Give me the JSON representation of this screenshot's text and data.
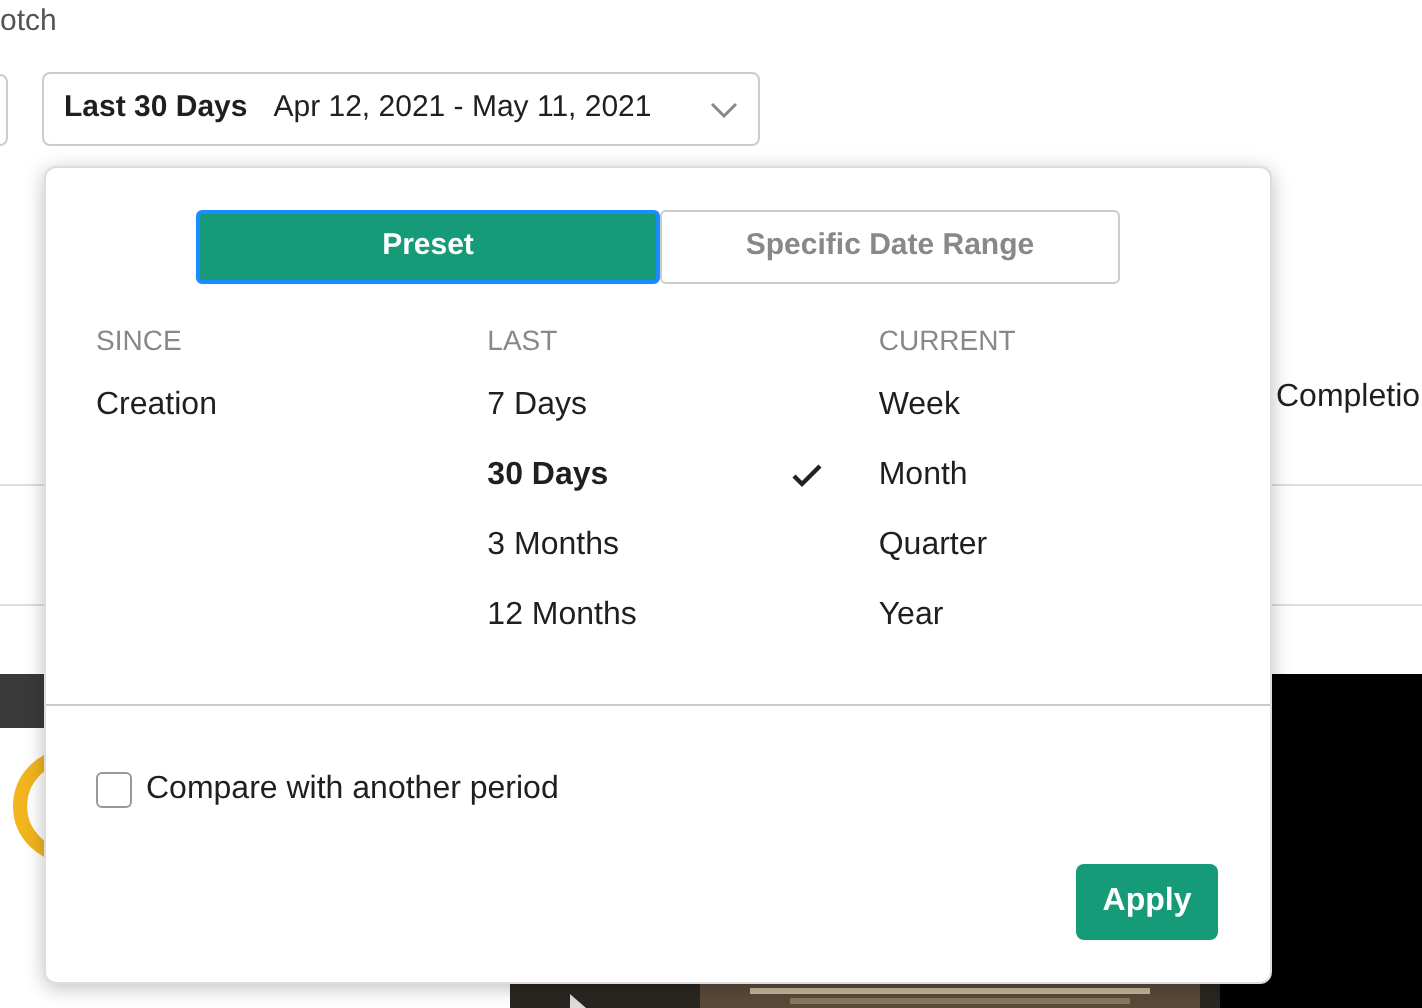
{
  "page": {
    "title_fragment": "otch",
    "date_picker": {
      "preset": "Last 30 Days",
      "range": "Apr 12, 2021 - May 11, 2021"
    },
    "card_fragment": "Completio"
  },
  "popover": {
    "tabs": [
      {
        "label": "Preset",
        "selected": true
      },
      {
        "label": "Specific Date Range",
        "selected": false
      }
    ],
    "columns": [
      {
        "heading": "SINCE",
        "options": [
          {
            "label": "Creation",
            "selected": false
          }
        ]
      },
      {
        "heading": "LAST",
        "options": [
          {
            "label": "7 Days",
            "selected": false
          },
          {
            "label": "30 Days",
            "selected": true
          },
          {
            "label": "3 Months",
            "selected": false
          },
          {
            "label": "12 Months",
            "selected": false
          }
        ]
      },
      {
        "heading": "CURRENT",
        "options": [
          {
            "label": "Week",
            "selected": false
          },
          {
            "label": "Month",
            "selected": false
          },
          {
            "label": "Quarter",
            "selected": false
          },
          {
            "label": "Year",
            "selected": false
          }
        ]
      }
    ],
    "compare": {
      "label": "Compare with another period",
      "checked": false
    },
    "apply": "Apply"
  }
}
